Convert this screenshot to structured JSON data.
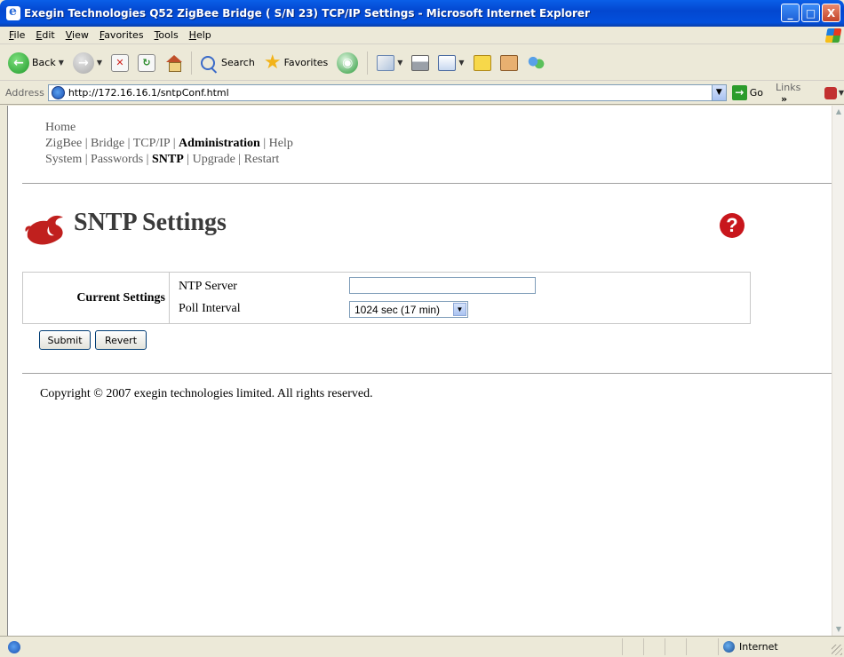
{
  "window": {
    "title": "Exegin Technologies Q52 ZigBee Bridge ( S/N 23) TCP/IP Settings - Microsoft Internet Explorer",
    "minimize": "_",
    "maximize": "□",
    "close": "X"
  },
  "menu": [
    "File",
    "Edit",
    "View",
    "Favorites",
    "Tools",
    "Help"
  ],
  "toolbar": {
    "back_label": "Back",
    "search_label": "Search",
    "favorites_label": "Favorites"
  },
  "address": {
    "label": "Address",
    "url": "http://172.16.16.1/sntpConf.html",
    "go_label": "Go",
    "links_label": "Links",
    "links_chevron": "»"
  },
  "nav": {
    "home": "Home",
    "row2": [
      "ZigBee",
      "Bridge",
      "TCP/IP",
      "Administration",
      "Help"
    ],
    "row2_active": "Administration",
    "row3": [
      "System",
      "Passwords",
      "SNTP",
      "Upgrade",
      "Restart"
    ],
    "row3_active": "SNTP",
    "separator": " | "
  },
  "page": {
    "title": "SNTP Settings",
    "help_glyph": "?"
  },
  "settings": {
    "header": "Current Settings",
    "ntp_server_label": "NTP Server",
    "ntp_server_value": "",
    "poll_interval_label": "Poll Interval",
    "poll_interval_value": "1024 sec (17 min)"
  },
  "buttons": {
    "submit": "Submit",
    "revert": "Revert"
  },
  "footer": {
    "copyright": "Copyright © 2007 exegin technologies limited. All rights reserved."
  },
  "status": {
    "zone": "Internet"
  },
  "colors": {
    "help_red": "#c8161c",
    "logo_red": "#c0201e"
  }
}
